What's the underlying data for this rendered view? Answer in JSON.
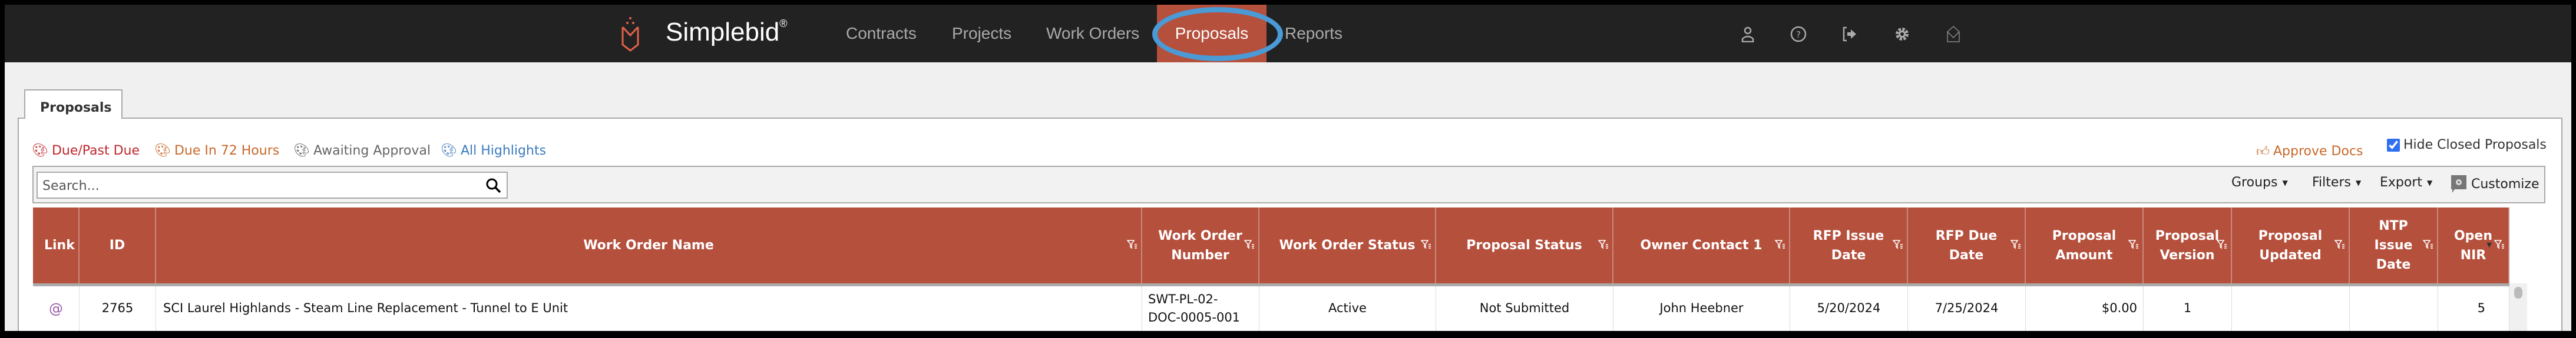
{
  "nav": {
    "brand": "Simplebid",
    "brand_mark": "®",
    "links": [
      "Contracts",
      "Projects",
      "Work Orders",
      "Proposals",
      "Reports"
    ],
    "active": "Proposals",
    "icons": [
      "user-icon",
      "help-icon",
      "logout-icon",
      "gear-icon",
      "mail-icon"
    ],
    "accent": "#b5503d",
    "highlight_ring": "#4a9ad6"
  },
  "tab": "Proposals",
  "highlights": [
    {
      "label": "Due/Past Due",
      "color": "#c0282d"
    },
    {
      "label": "Due In 72 Hours",
      "color": "#c8692a"
    },
    {
      "label": "Awaiting Approval",
      "color": "#666666"
    },
    {
      "label": "All Highlights",
      "color": "#3c7bc0"
    }
  ],
  "approve_docs": "Approve Docs",
  "hide_closed": {
    "label": "Hide Closed Proposals",
    "checked": true
  },
  "search": {
    "placeholder": "Search..."
  },
  "toolbar": {
    "groups": "Groups",
    "filters": "Filters",
    "export": "Export",
    "customize": "Customize"
  },
  "table": {
    "columns": [
      "Link",
      "ID",
      "Work Order Name",
      "Work Order Number",
      "Work Order Status",
      "Proposal Status",
      "Owner Contact 1",
      "RFP Issue Date",
      "RFP Due Date",
      "Proposal Amount",
      "Proposal Version",
      "Proposal Updated",
      "NTP Issue Date",
      "Open NIR"
    ],
    "rows": [
      [
        "",
        "2765",
        "SCI Laurel Highlands - Steam Line Replacement - Tunnel to E Unit",
        "SWT-PL-02-DOC-0005-001",
        "Active",
        "Not Submitted",
        "John Heebner",
        "5/20/2024",
        "7/25/2024",
        "$0.00",
        "1",
        "",
        "",
        "5"
      ]
    ]
  }
}
